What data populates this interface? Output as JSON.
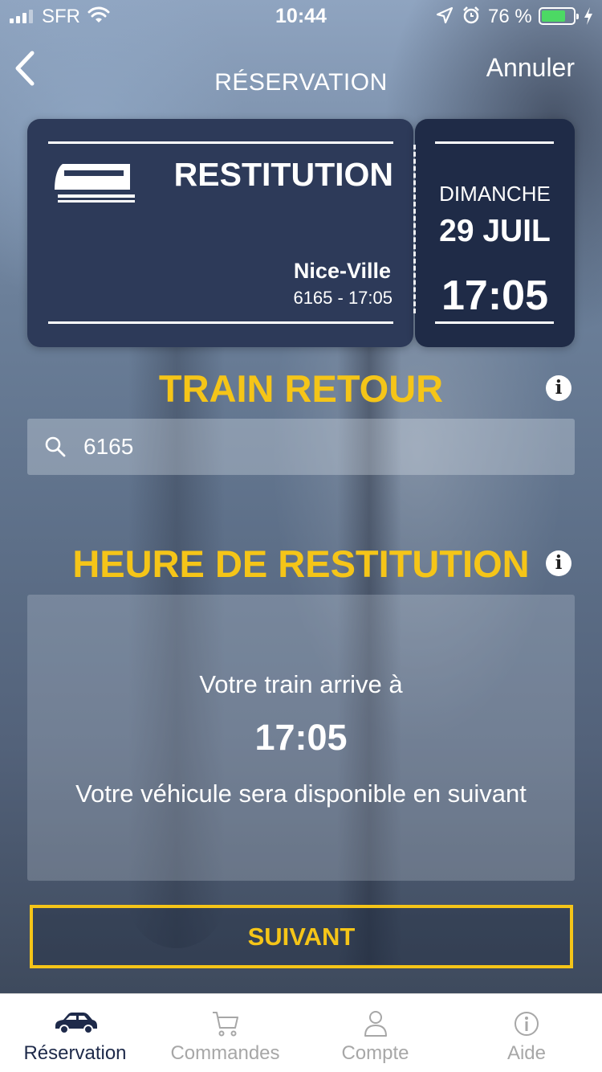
{
  "status_bar": {
    "carrier": "SFR",
    "time": "10:44",
    "battery_percent": "76 %",
    "battery_level": 0.76
  },
  "nav": {
    "title": "RÉSERVATION",
    "cancel_label": "Annuler"
  },
  "ticket": {
    "title": "RESTITUTION",
    "station": "Nice-Ville",
    "train_info": "6165 - 17:05",
    "day": "DIMANCHE",
    "date": "29 JUIL",
    "time": "17:05"
  },
  "train_retour": {
    "title": "TRAIN RETOUR",
    "search_value": "6165"
  },
  "heure": {
    "title": "HEURE DE RESTITUTION",
    "arrive_label": "Votre train arrive à",
    "arrive_time": "17:05",
    "dispo_label": "Votre véhicule sera disponible en suivant"
  },
  "next_button": "SUIVANT",
  "tabs": [
    {
      "label": "Réservation",
      "icon": "car-icon",
      "active": true
    },
    {
      "label": "Commandes",
      "icon": "cart-icon",
      "active": false
    },
    {
      "label": "Compte",
      "icon": "user-icon",
      "active": false
    },
    {
      "label": "Aide",
      "icon": "info-icon",
      "active": false
    }
  ],
  "colors": {
    "accent": "#f5c518",
    "ticket_main": "#2d3a59",
    "ticket_side": "#1f2b47",
    "tab_active": "#1e2a4a",
    "tab_inactive": "#a7a7a7"
  }
}
